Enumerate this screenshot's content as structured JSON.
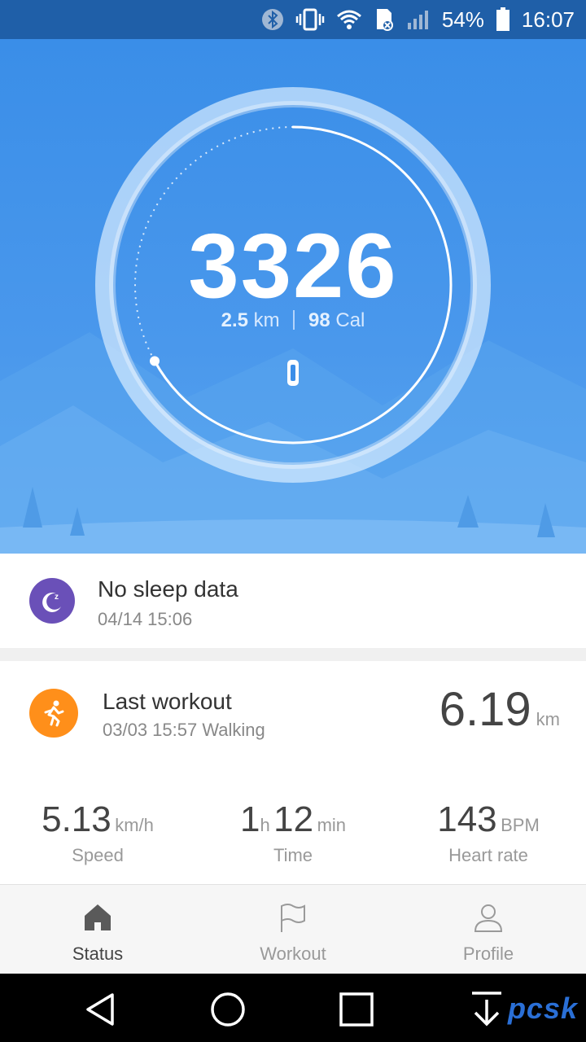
{
  "status_bar": {
    "battery_percent": "54%",
    "time": "16:07",
    "icons": [
      "bluetooth-icon",
      "vibrate-icon",
      "wifi-icon",
      "sd-card-icon",
      "signal-icon",
      "battery-icon"
    ]
  },
  "hero": {
    "steps": "3326",
    "distance_value": "2.5",
    "distance_unit": "km",
    "calories_value": "98",
    "calories_unit": "Cal",
    "goal_progress": 0.67,
    "device_icon": "band-icon"
  },
  "sleep": {
    "title": "No sleep data",
    "timestamp": "04/14 15:06",
    "icon": "moon-icon",
    "color": "#6a50b8"
  },
  "workout": {
    "title": "Last workout",
    "subtitle": "03/03 15:57 Walking",
    "distance_value": "6.19",
    "distance_unit": "km",
    "icon": "runner-icon",
    "color": "#ff8f1a",
    "metrics": [
      {
        "value": "5.13",
        "unit": "km/h",
        "label": "Speed"
      },
      {
        "hours": "1",
        "hours_unit": "h",
        "minutes": "12",
        "minutes_unit": "min",
        "label": "Time"
      },
      {
        "value": "143",
        "unit": "BPM",
        "label": "Heart rate"
      }
    ]
  },
  "tabs": [
    {
      "label": "Status",
      "icon": "home-icon",
      "active": true
    },
    {
      "label": "Workout",
      "icon": "flag-icon",
      "active": false
    },
    {
      "label": "Profile",
      "icon": "person-icon",
      "active": false
    }
  ],
  "watermark": "pcsk",
  "colors": {
    "hero": "#3a8ee8",
    "status_bar": "#1f5fa8"
  }
}
